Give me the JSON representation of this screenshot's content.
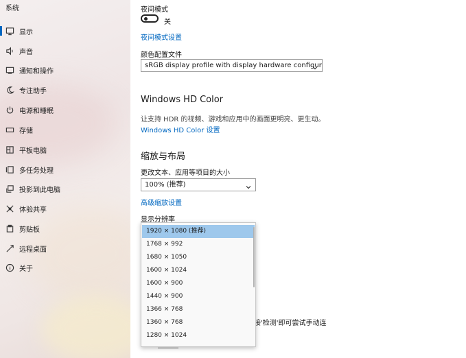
{
  "sidebar": {
    "title": "系统",
    "items": [
      {
        "label": "显示",
        "icon": "monitor-icon"
      },
      {
        "label": "声音",
        "icon": "speaker-icon"
      },
      {
        "label": "通知和操作",
        "icon": "notification-icon"
      },
      {
        "label": "专注助手",
        "icon": "moon-icon"
      },
      {
        "label": "电源和睡眠",
        "icon": "power-icon"
      },
      {
        "label": "存储",
        "icon": "storage-icon"
      },
      {
        "label": "平板电脑",
        "icon": "tablet-icon"
      },
      {
        "label": "多任务处理",
        "icon": "multitask-icon"
      },
      {
        "label": "投影到此电脑",
        "icon": "projection-icon"
      },
      {
        "label": "体验共享",
        "icon": "share-icon"
      },
      {
        "label": "剪贴板",
        "icon": "clipboard-icon"
      },
      {
        "label": "远程桌面",
        "icon": "remote-desktop-icon"
      },
      {
        "label": "关于",
        "icon": "info-icon"
      }
    ]
  },
  "night_light": {
    "label": "夜间模式",
    "toggle_state": "关",
    "settings_link": "夜间模式设置"
  },
  "color_profile": {
    "label": "颜色配置文件",
    "value": "sRGB display profile with display hardware configuration d..."
  },
  "hd_color": {
    "heading": "Windows HD Color",
    "description": "让支持 HDR 的视频、游戏和应用中的画面更明亮、更生动。",
    "link": "Windows HD Color 设置"
  },
  "scale_layout": {
    "heading": "缩放与布局",
    "scale_label": "更改文本、应用等项目的大小",
    "scale_value": "100% (推荐)",
    "advanced_link": "高级缩放设置",
    "resolution_label": "显示分辨率"
  },
  "resolution_options": [
    "1920 × 1080 (推荐)",
    "1768 × 992",
    "1680 × 1050",
    "1600 × 1024",
    "1600 × 900",
    "1440 × 900",
    "1366 × 768",
    "1360 × 768",
    "1280 × 1024"
  ],
  "resolution_selected_index": 0,
  "partial_text": "接'检测'即可尝试手动连"
}
